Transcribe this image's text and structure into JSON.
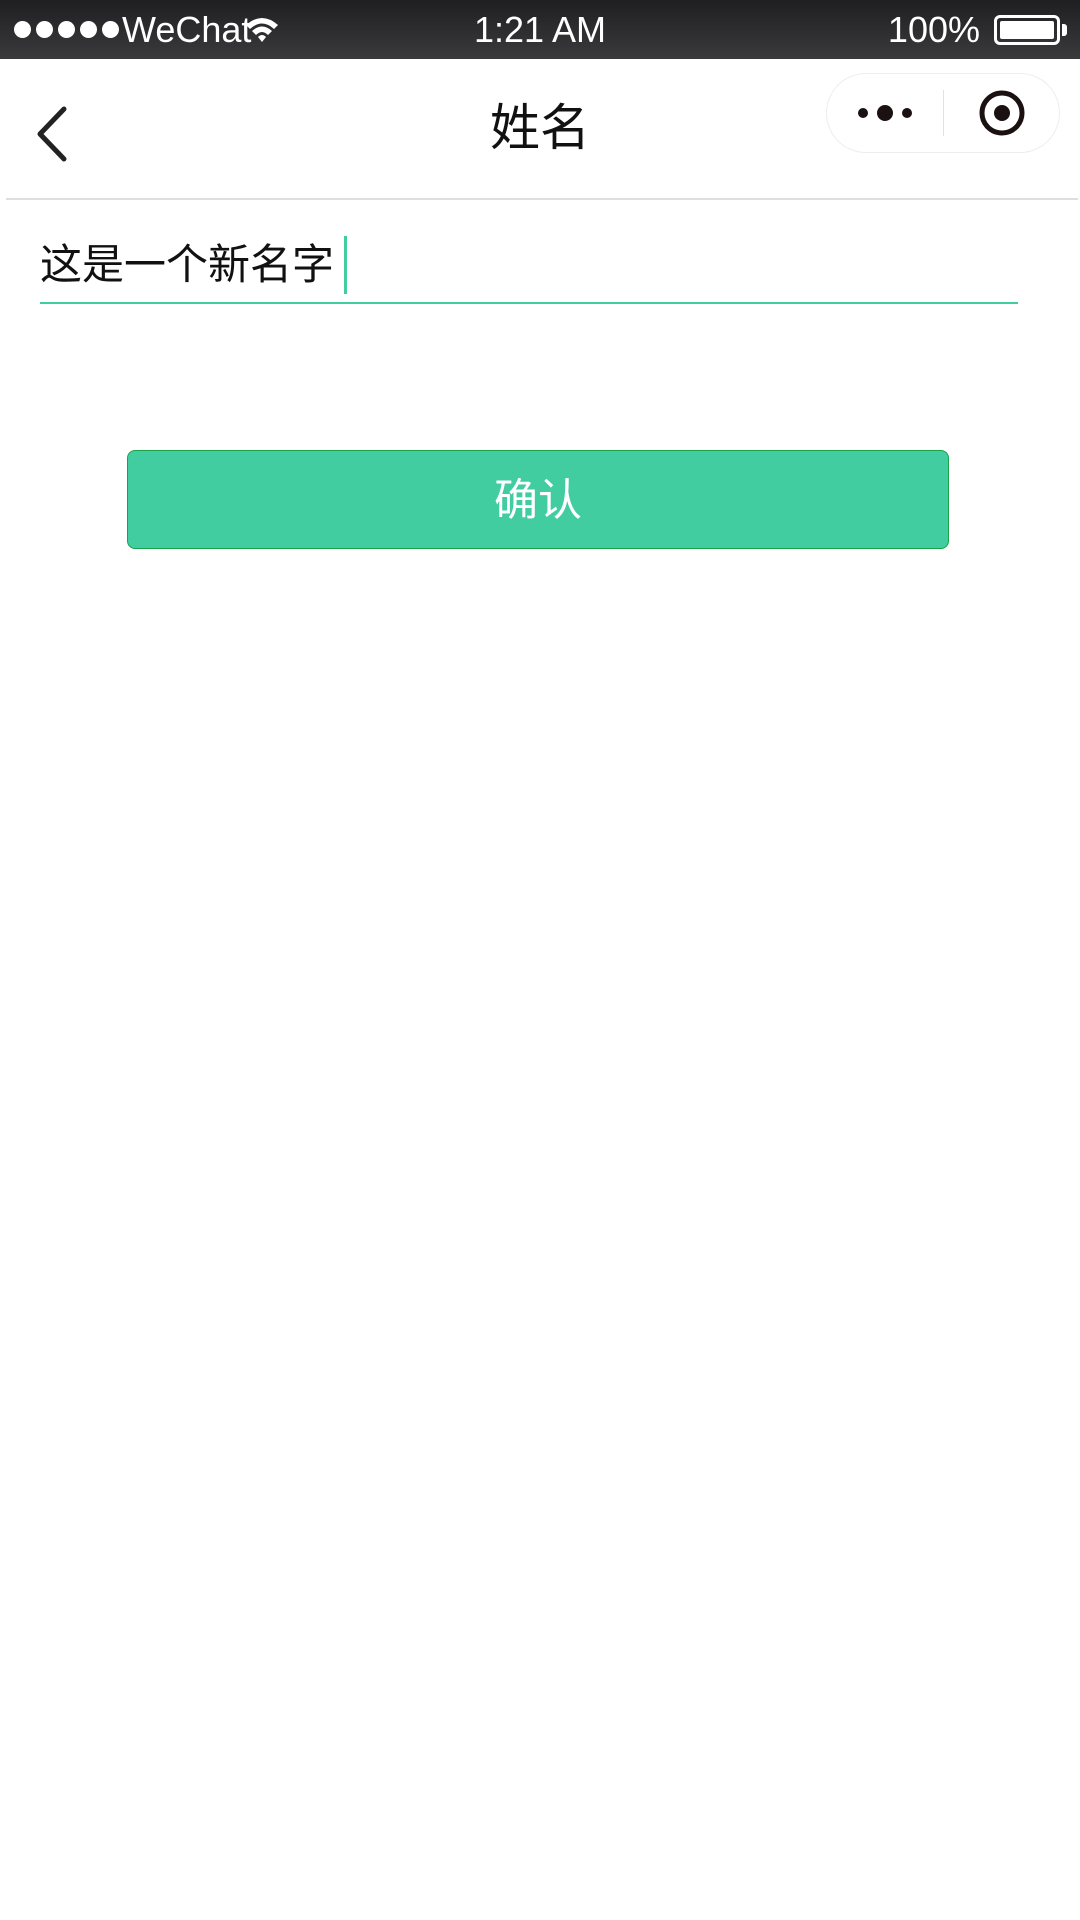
{
  "status_bar": {
    "carrier": "WeChat",
    "time": "1:21 AM",
    "battery": "100%",
    "signal_bars": 5
  },
  "nav": {
    "title": "姓名",
    "icons": {
      "back": "chevron-left-icon",
      "more": "more-dots-icon",
      "close": "target-circle-icon"
    }
  },
  "form": {
    "name_value": "这是一个新名字",
    "accent_color": "#42cda0"
  },
  "actions": {
    "confirm_label": "确认",
    "button_color": "#41cd9f"
  }
}
